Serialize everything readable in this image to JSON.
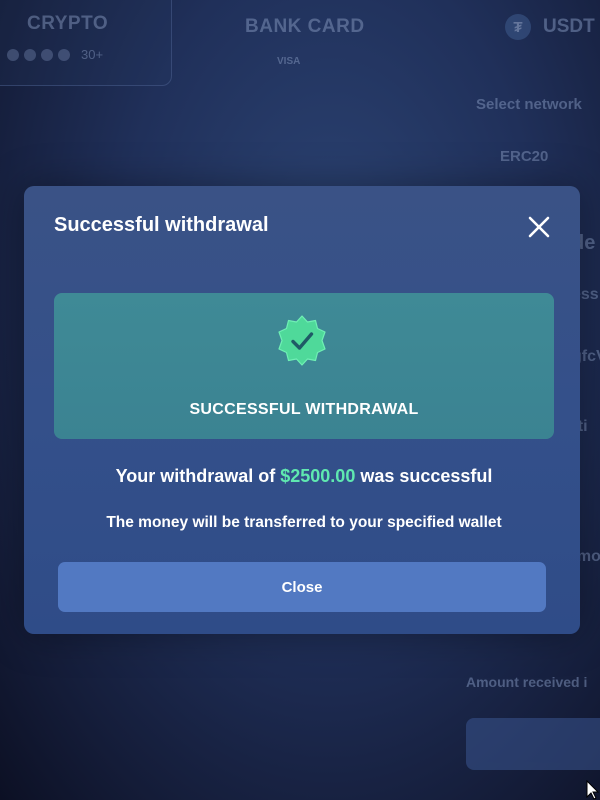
{
  "background": {
    "methods": [
      {
        "title": "CRYPTO",
        "extra": "30+"
      },
      {
        "title": "BANK CARD",
        "extra": "VISA"
      }
    ],
    "currency": {
      "icon": "tether-icon",
      "label": "USDT"
    },
    "select_network_label": "Select network",
    "network_value": "ERC20",
    "peek_texts": [
      "de",
      "ess",
      "gfcV",
      "pti",
      "amo"
    ],
    "amount_received_label": "Amount received i"
  },
  "modal": {
    "title": "Successful withdrawal",
    "close_icon": "close-icon",
    "banner": {
      "icon": "verified-badge-check-icon",
      "heading": "SUCCESSFUL WITHDRAWAL"
    },
    "message": {
      "prefix": "Your withdrawal of ",
      "amount": "$2500.00",
      "suffix": " was successful"
    },
    "sub_message": "The money will be transferred to your specified wallet",
    "close_button_label": "Close"
  },
  "colors": {
    "background": "#1c2a50",
    "modal": "#34508a",
    "banner": "#3d8794",
    "badge": "#4fd99a",
    "amount": "#5fe8b0",
    "button": "#5279c2"
  }
}
